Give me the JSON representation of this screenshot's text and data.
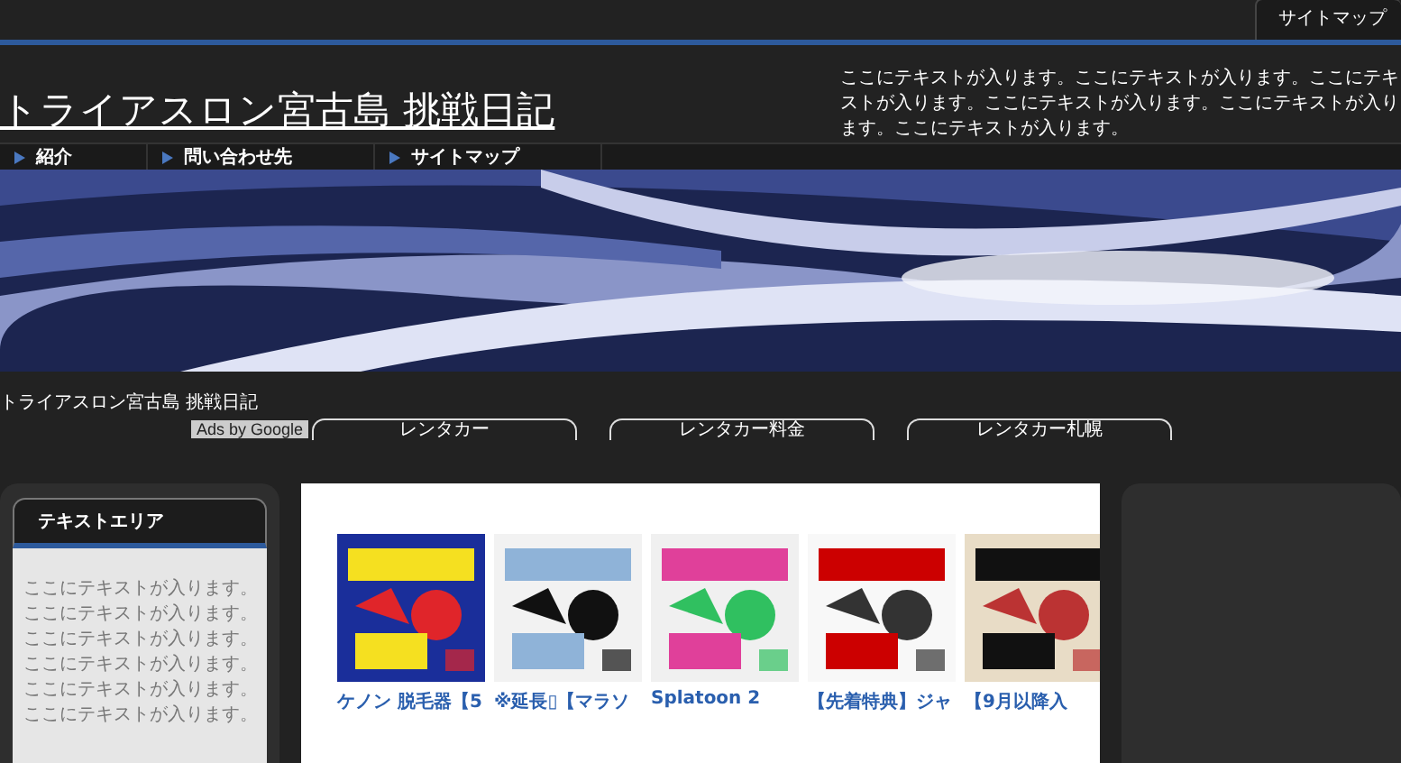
{
  "top_bar": {
    "link": "サイトマップ"
  },
  "header": {
    "title": "トライアスロン宮古島 挑戦日記",
    "description": "ここにテキストが入ります。ここにテキストが入ります。ここにテキストが入ります。ここにテキストが入ります。ここにテキストが入ります。ここにテキストが入ります。"
  },
  "nav": [
    {
      "label": "紹介"
    },
    {
      "label": "問い合わせ先"
    },
    {
      "label": "サイトマップ"
    }
  ],
  "breadcrumb": "トライアスロン宮古島 挑戦日記",
  "ads": {
    "badge": "Ads by Google",
    "links": [
      "レンタカー",
      "レンタカー料金",
      "レンタカー札幌"
    ]
  },
  "sidebar": {
    "title": "テキストエリア",
    "lines": [
      "ここにテキストが入ります。",
      "ここにテキストが入ります。",
      "ここにテキストが入ります。",
      "ここにテキストが入ります。",
      "ここにテキストが入ります。",
      "ここにテキストが入ります。"
    ]
  },
  "products": [
    {
      "caption": "ケノン 脱毛器【5",
      "kind": "picture"
    },
    {
      "caption": "※延長▯【マラソ",
      "kind": "picture"
    },
    {
      "caption": "Splatoon 2",
      "kind": "picture"
    },
    {
      "caption": "【先着特典】ジャ",
      "kind": "picture"
    },
    {
      "caption": "【9月以降入",
      "kind": "picture"
    }
  ]
}
